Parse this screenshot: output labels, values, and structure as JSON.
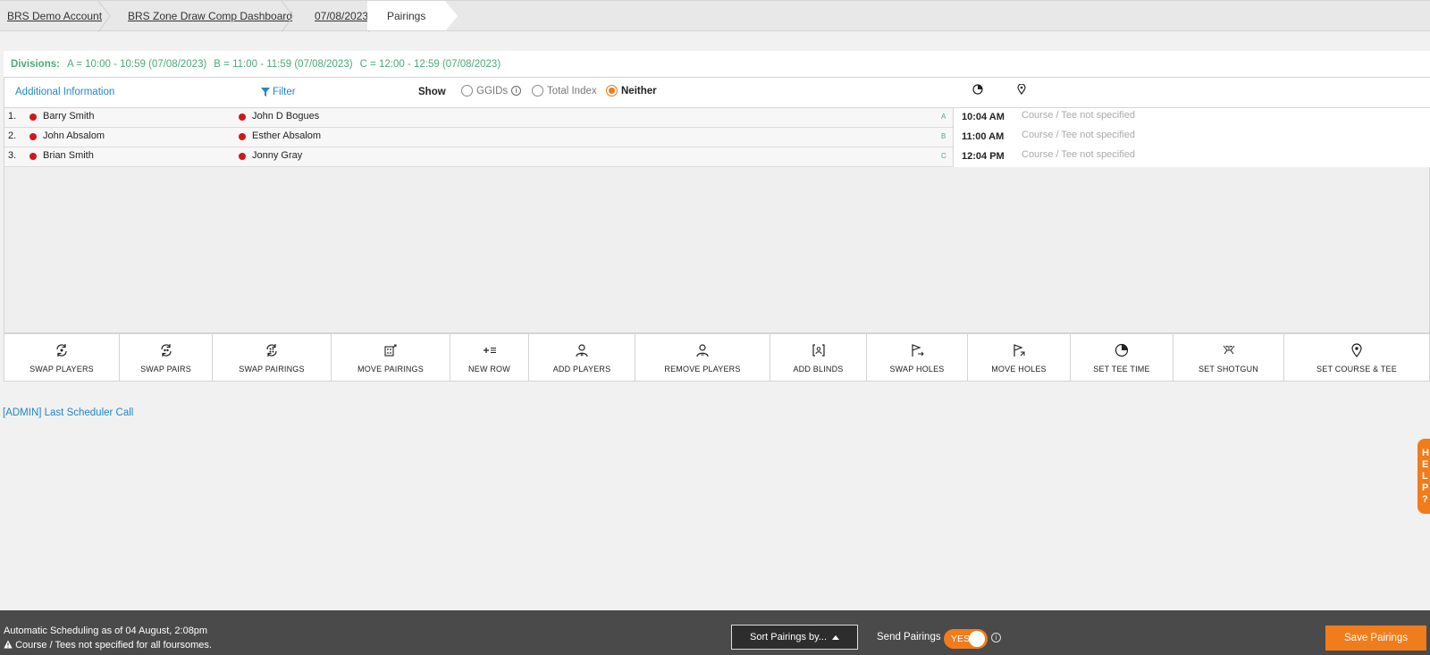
{
  "breadcrumb": {
    "items": [
      "BRS Demo Account",
      "BRS Zone Draw Comp Dashboard",
      "07/08/2023"
    ],
    "active": "Pairings"
  },
  "divisions": {
    "label": "Divisions:",
    "items": [
      "A = 10:00 - 10:59 (07/08/2023)",
      "B = 11:00 - 11:59 (07/08/2023)",
      "C = 12:00 - 12:59 (07/08/2023)"
    ]
  },
  "header": {
    "additional_info": "Additional Information",
    "filter": "Filter",
    "show": "Show",
    "options": [
      "GGIDs",
      "Total Index",
      "Neither"
    ],
    "selected": "Neither",
    "icons": [
      "clock-icon",
      "location-pin-icon"
    ]
  },
  "pairings": [
    {
      "num": "1.",
      "player1": "Barry Smith",
      "player2": "John D Bogues",
      "division": "A",
      "time": "10:04 AM",
      "course": "Course / Tee not specified"
    },
    {
      "num": "2.",
      "player1": "John Absalom",
      "player2": "Esther Absalom",
      "division": "B",
      "time": "11:00 AM",
      "course": "Course / Tee not specified"
    },
    {
      "num": "3.",
      "player1": "Brian Smith",
      "player2": "Jonny Gray",
      "division": "C",
      "time": "12:04 PM",
      "course": "Course / Tee not specified"
    }
  ],
  "player_dot_color": "#d01818",
  "toolbar": [
    {
      "label": "SWAP PLAYERS",
      "icon": "swap-players-icon"
    },
    {
      "label": "SWAP PAIRS",
      "icon": "swap-pairs-icon"
    },
    {
      "label": "SWAP PAIRINGS",
      "icon": "swap-pairings-icon"
    },
    {
      "label": "MOVE PAIRINGS",
      "icon": "move-pairings-icon"
    },
    {
      "label": "NEW ROW",
      "icon": "new-row-icon"
    },
    {
      "label": "ADD PLAYERS",
      "icon": "add-player-icon"
    },
    {
      "label": "REMOVE PLAYERS",
      "icon": "remove-player-icon"
    },
    {
      "label": "ADD BLINDS",
      "icon": "add-blinds-icon"
    },
    {
      "label": "SWAP HOLES",
      "icon": "swap-holes-icon"
    },
    {
      "label": "MOVE HOLES",
      "icon": "move-holes-icon"
    },
    {
      "label": "SET TEE TIME",
      "icon": "clock-icon"
    },
    {
      "label": "SET SHOTGUN",
      "icon": "shotgun-icon"
    },
    {
      "label": "SET COURSE & TEE",
      "icon": "location-pin-icon"
    }
  ],
  "admin_link": "[ADMIN] Last Scheduler Call",
  "help_tab": [
    "H",
    "E",
    "L",
    "P",
    "?"
  ],
  "footer": {
    "schedule_line1": "Automatic Scheduling as of 04 August, 2:08pm",
    "schedule_line2": "Course / Tees not specified for all foursomes.",
    "sort_button": "Sort Pairings by...",
    "send_label": "Send Pairings",
    "toggle_text": "YES",
    "save_button": "Save Pairings"
  },
  "colors": {
    "accent_orange": "#f07c1c",
    "link_blue": "#1f88c8",
    "division_green": "#4aab7a",
    "footer_bg": "#4a4a4a"
  }
}
